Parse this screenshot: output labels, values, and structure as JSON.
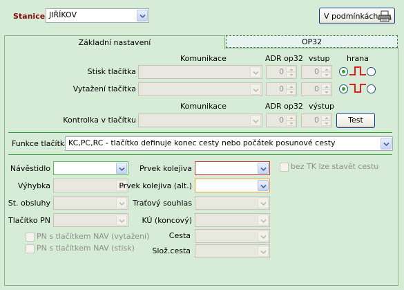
{
  "header": {
    "station_label": "Stanice",
    "station_value": "JIŘÍKOV",
    "conditions_button": "V podmínkách"
  },
  "tabs": [
    {
      "label": "Základní nastavení",
      "active": true
    },
    {
      "label": "OP32",
      "active": false
    }
  ],
  "comm_section_1": {
    "col_comm": "Komunikace",
    "col_adr": "ADR op32",
    "col_input": "vstup",
    "col_edge": "hrana",
    "rows": [
      {
        "label": "Stisk tlačítka",
        "comm": "",
        "adr": "0",
        "input": "0",
        "edge_rising_selected": true
      },
      {
        "label": "Vytažení tlačítka",
        "comm": "",
        "adr": "0",
        "input": "0",
        "edge_rising_selected": true
      }
    ]
  },
  "comm_section_2": {
    "col_comm": "Komunikace",
    "col_adr": "ADR op32",
    "col_output": "výstup",
    "row": {
      "label": "Kontrolka v tlačítku",
      "comm": "",
      "adr": "0",
      "output": "0"
    },
    "test_button": "Test"
  },
  "function": {
    "label": "Funkce tlačítka",
    "value": "KC,PC,RC - tlačítko definuje konec cesty nebo počátek posunové cesty"
  },
  "left_fields": [
    {
      "label": "Návěstidlo",
      "value": "",
      "enabled": true
    },
    {
      "label": "Výhybka",
      "value": "",
      "enabled": false
    },
    {
      "label": "St. obsluhy",
      "value": "",
      "enabled": false
    },
    {
      "label": "Tlačítko PN",
      "value": "",
      "enabled": false
    }
  ],
  "checkboxes_left": [
    {
      "label": "PN s tlačítkem NAV (vytažení)",
      "checked": false
    },
    {
      "label": "PN s tlačítkem NAV (stisk)",
      "checked": false
    }
  ],
  "right_fields": [
    {
      "label": "Prvek kolejiva",
      "value": "",
      "enabled": true
    },
    {
      "label": "Prvek kolejiva (alt.)",
      "value": "",
      "enabled": true
    },
    {
      "label": "Traťový souhlas",
      "value": "",
      "enabled": false
    },
    {
      "label": "KÚ (koncový)",
      "value": "",
      "enabled": false
    },
    {
      "label": "Cesta",
      "value": "",
      "enabled": false
    },
    {
      "label": "Slož.cesta",
      "value": "",
      "enabled": false
    }
  ],
  "checkbox_right": {
    "label": "bez TK lze stavět cestu",
    "checked": false
  },
  "colors": {
    "background": "#d7ecd6",
    "separator": "#2e9e2e",
    "required_border": "#d53a3a",
    "alt_border": "#ec9a3a",
    "signal_border": "#50c050",
    "edge_signal": "#e02020"
  },
  "icons": {
    "dropdown": "chevron-down-icon",
    "printer": "printer-icon",
    "edge_rising": "rising-edge-icon",
    "edge_falling": "falling-edge-icon"
  }
}
